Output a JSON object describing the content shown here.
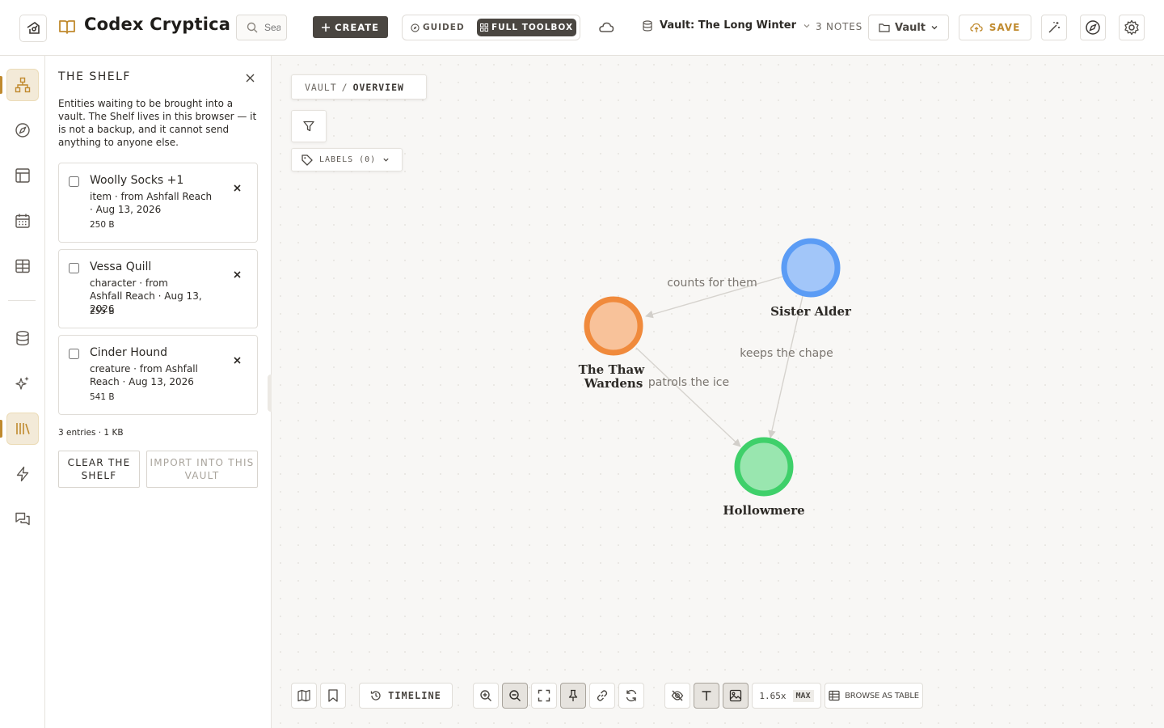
{
  "header": {
    "app_title": "Codex Cryptica",
    "search_placeholder": "Search",
    "create_label": "CREATE",
    "mode_guided_label": "GUIDED",
    "mode_full_label": "FULL TOOLBOX",
    "vault_name": "Vault: The Long Winter",
    "notes_count": "3 NOTES",
    "vault_button_label": "Vault",
    "save_label": "SAVE",
    "accent_color": "#c08a2e"
  },
  "rail": {
    "items": [
      "graph-icon",
      "compass-icon",
      "canvas-icon",
      "calendar-icon",
      "table-icon",
      "database-icon",
      "sparkle-icon",
      "shelf-icon",
      "lightning-icon",
      "chat-icon"
    ],
    "active": "shelf-icon"
  },
  "shelf": {
    "title": "THE SHELF",
    "description": "Entities waiting to be brought into a vault. The Shelf lives in this browser — it is not a backup, and it cannot send anything to anyone else.",
    "entries": [
      {
        "name": "Woolly Socks +1",
        "meta": "item · from Ashfall Reach · Aug 13, 2026",
        "size": "250 B"
      },
      {
        "name": "Vessa Quill",
        "meta": "character · from Ashfall Reach · Aug 13, 2026",
        "size": "255 B"
      },
      {
        "name": "Cinder Hound",
        "meta": "creature · from Ashfall Reach · Aug 13, 2026",
        "size": "541 B"
      }
    ],
    "summary": "3 entries · 1 KB",
    "clear_label": "CLEAR THE SHELF",
    "import_label": "IMPORT INTO THIS VAULT"
  },
  "canvas": {
    "breadcrumb_root": "VAULT",
    "breadcrumb_sep": "/",
    "breadcrumb_current": "OVERVIEW",
    "labels_button": "LABELS (0)",
    "nodes": [
      {
        "id": "sister-alder",
        "label": "Sister Alder",
        "color": "#5b9cf5"
      },
      {
        "id": "thaw-wardens",
        "label": "The Thaw Wardens",
        "color": "#f08a3c"
      },
      {
        "id": "hollowmere",
        "label": "Hollowmere",
        "color": "#3fd06a"
      }
    ],
    "edges": [
      {
        "from": "sister-alder",
        "to": "thaw-wardens",
        "label": "counts for them"
      },
      {
        "from": "sister-alder",
        "to": "hollowmere",
        "label": "keeps the chape"
      },
      {
        "from": "thaw-wardens",
        "to": "hollowmere",
        "label": "patrols the ice"
      }
    ]
  },
  "toolbar": {
    "timeline_label": "TIMELINE",
    "zoom_value": "1.65x",
    "zoom_max": "MAX",
    "browse_label": "BROWSE AS TABLE"
  }
}
